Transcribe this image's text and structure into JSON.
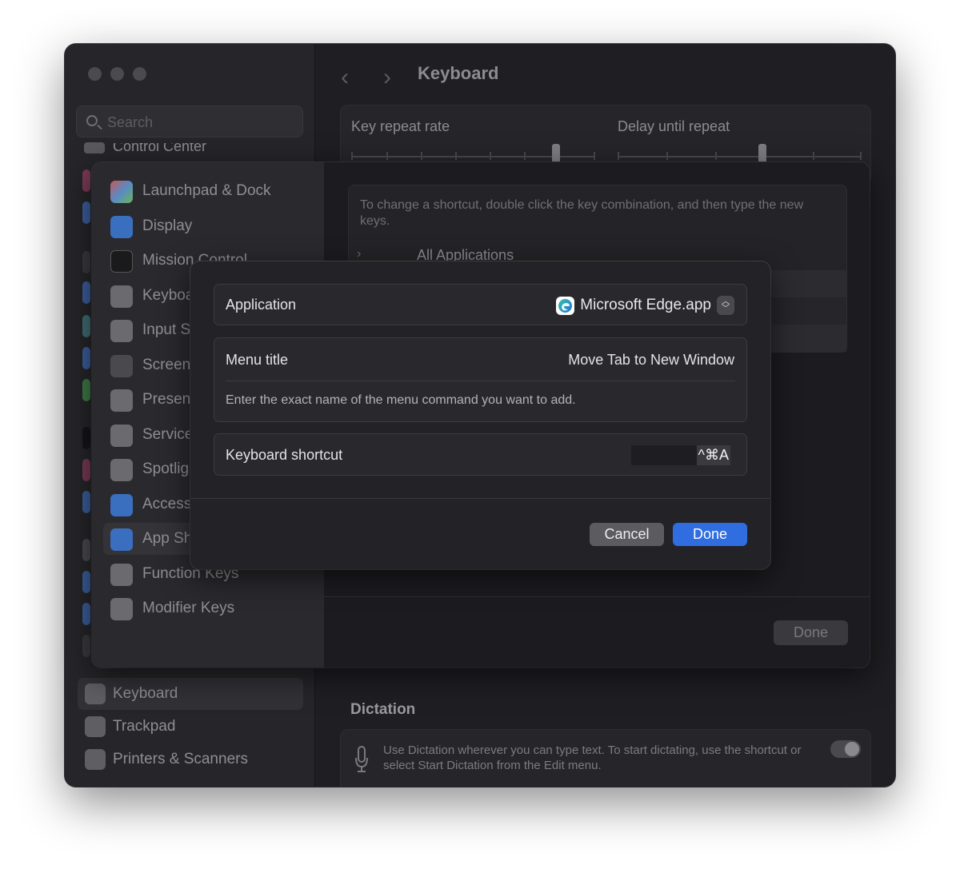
{
  "window": {
    "title": "Keyboard",
    "search_placeholder": "Search",
    "sidebar_peek": "Control Center",
    "sidebar_bottom": [
      {
        "label": "Keyboard",
        "icon": "keyboard-icon",
        "selected": true
      },
      {
        "label": "Trackpad",
        "icon": "trackpad-icon",
        "selected": false
      },
      {
        "label": "Printers & Scanners",
        "icon": "printer-icon",
        "selected": false
      }
    ],
    "key_repeat_label": "Key repeat rate",
    "delay_label": "Delay until repeat",
    "dictation": {
      "title": "Dictation",
      "text": "Use Dictation wherever you can type text. To start dictating, use the shortcut or select Start Dictation from the Edit menu."
    }
  },
  "sheet": {
    "items": [
      {
        "label": "Launchpad & Dock",
        "icon": "launchpad-icon"
      },
      {
        "label": "Display",
        "icon": "display-icon"
      },
      {
        "label": "Mission Control",
        "icon": "mission-control-icon"
      },
      {
        "label": "Keyboard",
        "icon": "keyboard-icon"
      },
      {
        "label": "Input Sources",
        "icon": "input-sources-icon"
      },
      {
        "label": "Screenshots",
        "icon": "screenshot-icon"
      },
      {
        "label": "Presenter Overlay",
        "icon": "presenter-icon"
      },
      {
        "label": "Services",
        "icon": "services-icon"
      },
      {
        "label": "Spotlight",
        "icon": "spotlight-icon"
      },
      {
        "label": "Accessibility",
        "icon": "accessibility-icon"
      },
      {
        "label": "App Shortcuts",
        "icon": "app-shortcuts-icon"
      },
      {
        "label": "Function Keys",
        "icon": "function-keys-icon"
      },
      {
        "label": "Modifier Keys",
        "icon": "modifier-keys-icon"
      }
    ],
    "hint": "To change a shortcut, double click the key combination, and then type the new keys.",
    "all_applications": "All Applications",
    "done_label": "Done"
  },
  "dialog": {
    "application_label": "Application",
    "application_value": "Microsoft Edge.app",
    "menu_title_label": "Menu title",
    "menu_title_value": "Move Tab to New Window",
    "menu_help": "Enter the exact name of the menu command you want to add.",
    "shortcut_label": "Keyboard shortcut",
    "shortcut_value": "^⌘A",
    "cancel_label": "Cancel",
    "done_label": "Done"
  },
  "colors": {
    "accent": "#2f6de1",
    "window_bg": "#1f1e22",
    "dialog_bg": "#232227"
  }
}
